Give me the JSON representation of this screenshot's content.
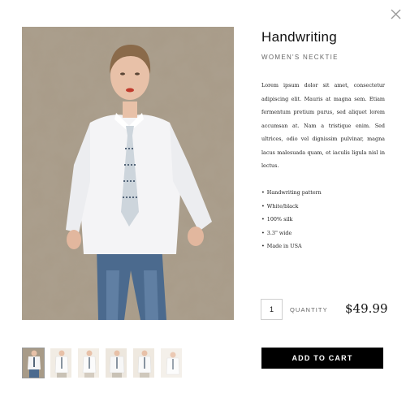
{
  "product": {
    "title": "Handwriting",
    "subtitle": "WOMEN'S NECKTIE",
    "description": "Lorem ipsum dolor sit amet, consectetur adipiscing elit. Mauris at magna sem. Etiam fermentum pretium purus, sed aliquet lorem accumsan at. Nam a tristique enim. Sed ultrices, odio vel dignissim pulvinar, magna lacus malesuada quam, et iaculis ligula nisl in lectus.",
    "features": [
      "Handwriting pattern",
      "White/black",
      "100% silk",
      "3.3\" wide",
      "Made in USA"
    ],
    "price": "$49.99"
  },
  "purchase": {
    "quantity": "1",
    "quantity_label": "QUANTITY",
    "add_to_cart_label": "ADD TO CART"
  },
  "gallery": {
    "thumbnail_count": 6,
    "selected_index": 0
  },
  "icons": {
    "close": "close-icon"
  },
  "colors": {
    "background": "#ffffff",
    "button": "#000000",
    "button_text": "#ffffff",
    "muted_text": "#666666",
    "wall": "#a89b88"
  }
}
